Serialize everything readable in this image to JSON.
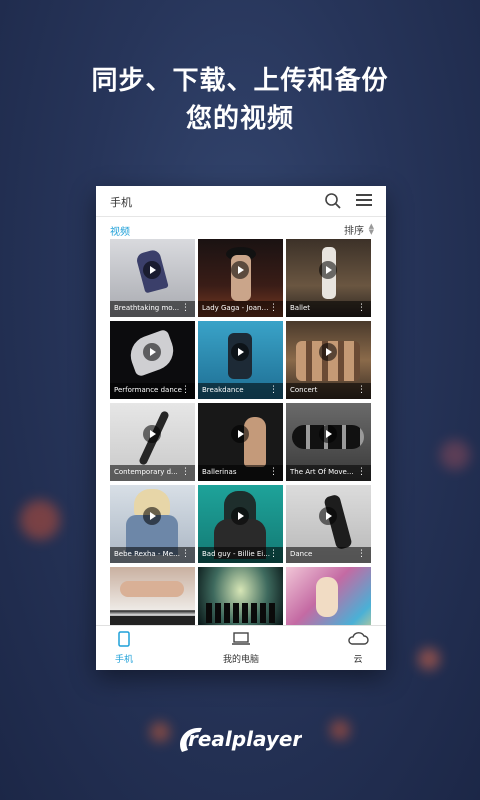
{
  "promo": {
    "headline_line1": "同步、下载、上传和备份",
    "headline_line2": "您的视频"
  },
  "app": {
    "top_bar": {
      "title": "手机"
    },
    "section_label": "视频",
    "sort_label": "排序",
    "videos": [
      {
        "title": "Breathtaking mo..."
      },
      {
        "title": "Lady Gaga - Joanne"
      },
      {
        "title": "Ballet"
      },
      {
        "title": "Performance dance"
      },
      {
        "title": "Breakdance"
      },
      {
        "title": "Concert"
      },
      {
        "title": "Contemporary d..."
      },
      {
        "title": "Ballerinas"
      },
      {
        "title": "The Art Of Move..."
      },
      {
        "title": "Bebe Rexha - Mea..."
      },
      {
        "title": "Bad guy - Billie Ei..."
      },
      {
        "title": "Dance"
      },
      {
        "title": ""
      },
      {
        "title": ""
      },
      {
        "title": ""
      }
    ],
    "tabs": [
      {
        "label": "手机"
      },
      {
        "label": "我的电脑"
      },
      {
        "label": "云"
      }
    ],
    "accent_color": "#1fa0d8"
  },
  "brand": {
    "logo_text": "realplayer"
  }
}
